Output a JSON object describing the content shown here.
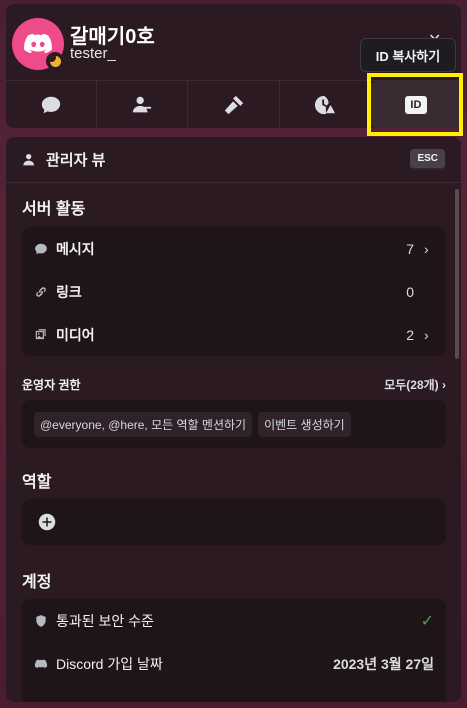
{
  "profile": {
    "display_name": "갈매기0호",
    "username": "tester_",
    "avatar_color": "#ef4b8a",
    "status": "idle"
  },
  "tooltip": "ID 복사하기",
  "tabs": [
    {
      "icon": "message-icon"
    },
    {
      "icon": "user-manage-icon"
    },
    {
      "icon": "hammer-icon"
    },
    {
      "icon": "timeout-warning-icon"
    },
    {
      "icon": "id-icon",
      "label": "ID"
    }
  ],
  "panel": {
    "title": "관리자 뷰",
    "esc_label": "ESC",
    "server_activity": {
      "label": "서버 활동",
      "rows": [
        {
          "icon": "message-bubble-icon",
          "label": "메시지",
          "count": "7",
          "chevron": true
        },
        {
          "icon": "link-icon",
          "label": "링크",
          "count": "0",
          "chevron": false
        },
        {
          "icon": "media-icon",
          "label": "미디어",
          "count": "2",
          "chevron": true
        }
      ]
    },
    "permissions": {
      "label": "운영자 권한",
      "all_label": "모두(28개)",
      "chips": [
        "@everyone, @here, 모든 역할 멘션하기",
        "이벤트 생성하기"
      ]
    },
    "roles": {
      "label": "역할"
    },
    "account": {
      "label": "계정",
      "rows": [
        {
          "icon": "shield-icon",
          "label": "통과된 보안 수준"
        },
        {
          "icon": "discord-icon",
          "label": "Discord 가입 날짜",
          "value": "2023년 3월 27일"
        }
      ]
    }
  },
  "colors": {
    "accent_check": "#3ba55c",
    "highlight": "#ffef00"
  }
}
